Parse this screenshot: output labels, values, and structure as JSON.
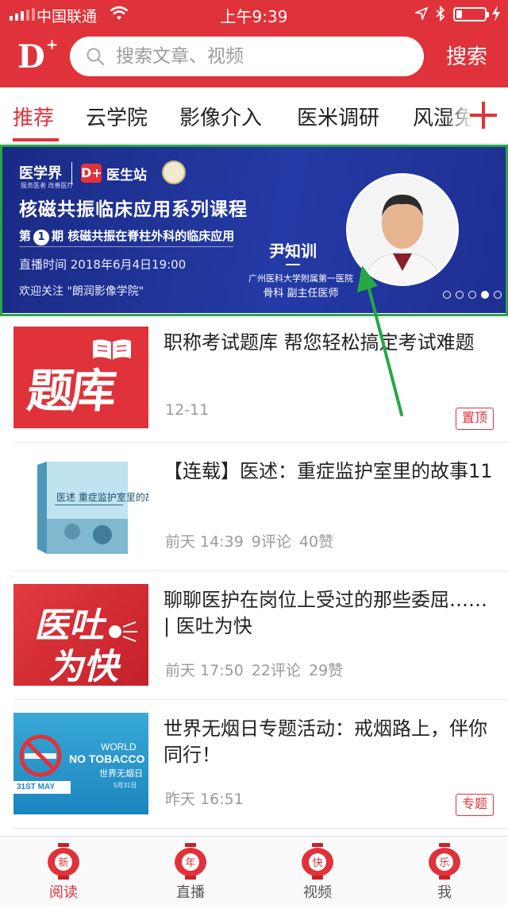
{
  "status_bar": {
    "carrier": "中国联通",
    "time": "上午9:39"
  },
  "header": {
    "logo_text": "D",
    "logo_plus": "+",
    "search_placeholder": "搜索文章、视频",
    "search_button": "搜索"
  },
  "tabs": {
    "items": [
      "推荐",
      "云学院",
      "影像介入",
      "医米调研",
      "风湿免"
    ],
    "active": "推荐"
  },
  "banner": {
    "brand": "医学界",
    "brand_sub": "服务医者 改善医疗",
    "dplus": "D+",
    "station": "医生站",
    "title": "核磁共振临床应用系列课程",
    "issue_prefix": "第",
    "issue_number": "1",
    "issue_suffix": "期 核磁共振在脊柱外科的临床应用",
    "live_time": "直播时间 2018年6月4日19:00",
    "follow": "欢迎关注 \"朗润影像学院\"",
    "doctor_name": "尹知训",
    "doctor_hospital": "广州医科大学附属第一医院",
    "doctor_title": "骨科  副主任医师",
    "slide_count": 5,
    "active_slide": 4
  },
  "news": [
    {
      "title": "职称考试题库  帮您轻松搞定考试难题",
      "date": "12-11",
      "comments": "",
      "likes": "",
      "tag": "置顶",
      "thumb_text": "题库"
    },
    {
      "title": "【连载】医述：重症监护室里的故事11",
      "date": "前天 14:39",
      "comments": "9评论",
      "likes": "40赞",
      "tag": "",
      "thumb_text": "医述 重症监护室里的故事"
    },
    {
      "title": "聊聊医护在岗位上受过的那些委屈…… | 医吐为快",
      "date": "前天 17:50",
      "comments": "22评论",
      "likes": "29赞",
      "tag": "",
      "thumb_text_1": "医吐",
      "thumb_text_2": "为快"
    },
    {
      "title": "世界无烟日专题活动：戒烟路上，伴你同行！",
      "date": "昨天 16:51",
      "comments": "",
      "likes": "",
      "tag": "专题",
      "thumb_w1": "WORLD",
      "thumb_w2": "NO TOBACCO",
      "thumb_w3": "世界无烟日",
      "thumb_w4": "5月31日",
      "thumb_ribbon": "31ST MAY"
    }
  ],
  "tabbar": [
    {
      "label": "阅读",
      "glyph": "新",
      "active": true
    },
    {
      "label": "直播",
      "glyph": "年",
      "active": false
    },
    {
      "label": "视频",
      "glyph": "快",
      "active": false
    },
    {
      "label": "我",
      "glyph": "乐",
      "active": false
    }
  ],
  "colors": {
    "brand_red": "#e0323a",
    "banner_blue": "#243aa6",
    "annotation_green": "#27a745"
  }
}
